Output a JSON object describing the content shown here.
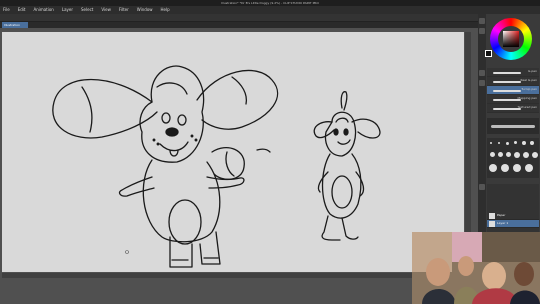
{
  "window": {
    "title": "Illustration* *Dr B's Little Doggy (9.2%) - CLIP STUDIO PAINT PRO"
  },
  "menu": [
    "File",
    "Edit",
    "Animation",
    "Layer",
    "Select",
    "View",
    "Filter",
    "Window",
    "Help"
  ],
  "tabs": [
    {
      "label": "Illustration"
    }
  ],
  "brush_panel": {
    "items": [
      {
        "label": "G-pen"
      },
      {
        "label": "Real G-pen"
      },
      {
        "label": "Turnip pen"
      },
      {
        "label": "Mapping pen"
      },
      {
        "label": "Textured pen"
      }
    ],
    "selected_index": 2
  },
  "layers": [
    {
      "label": "Layer 1"
    },
    {
      "label": "Paper"
    }
  ],
  "colors": {
    "canvas": "#d9d9d9",
    "accent": "#4a6f9c",
    "ink": "#1a1a1a"
  }
}
